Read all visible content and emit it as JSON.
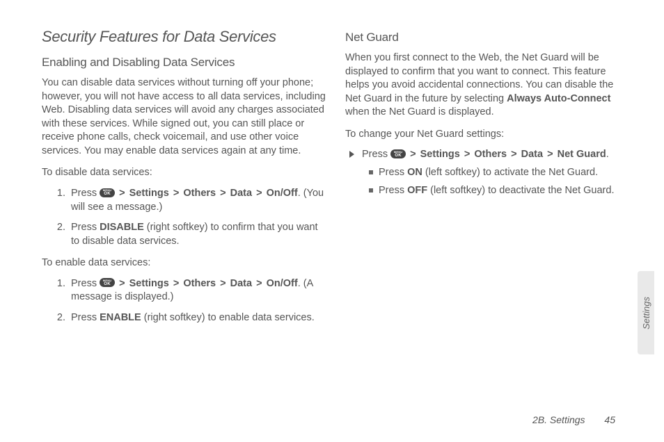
{
  "heading": "Security Features for Data Services",
  "sec1": {
    "title": "Enabling and Disabling Data Services",
    "intro": "You can disable data services without turning off your phone; however, you will not have access to all data services, including Web. Disabling data services will avoid any charges associated with these services. While signed out, you can still place or receive phone calls, check voicemail, and use other voice services. You may enable data services again at any time.",
    "disable_head": "To disable data services:",
    "d1_pre": "Press ",
    "d1_path_settings": "Settings",
    "d1_path_others": "Others",
    "d1_path_data": "Data",
    "d1_path_onoff": "On/Off",
    "d1_post": ". (You will see a message.)",
    "d2_pre": "Press ",
    "d2_bold": "DISABLE",
    "d2_post": " (right softkey) to confirm that you want to disable data services.",
    "enable_head": "To enable data services:",
    "e1_pre": "Press ",
    "e1_post": ". (A message is displayed.)",
    "e2_pre": "Press ",
    "e2_bold": "ENABLE",
    "e2_post": " (right softkey) to enable data services."
  },
  "sec2": {
    "title": "Net Guard",
    "intro_pre": "When you first connect to the Web, the Net Guard will be displayed to confirm that you want to connect. This feature helps you avoid accidental connections. You can disable the Net Guard in the future by selecting ",
    "intro_bold": "Always Auto-Connect",
    "intro_post": " when the Net Guard is displayed.",
    "change_head": "To change your Net Guard settings:",
    "b_pre": "Press ",
    "b_path_ng": "Net Guard",
    "s1_pre": "Press ",
    "s1_bold": "ON",
    "s1_post": " (left softkey) to activate the Net Guard.",
    "s2_pre": "Press ",
    "s2_bold": "OFF",
    "s2_post": " (left softkey) to deactivate the Net Guard."
  },
  "gt": ">",
  "ok_top": "MENU",
  "ok": "OK",
  "side_tab": "Settings",
  "footer_section": "2B. Settings",
  "footer_page": "45"
}
